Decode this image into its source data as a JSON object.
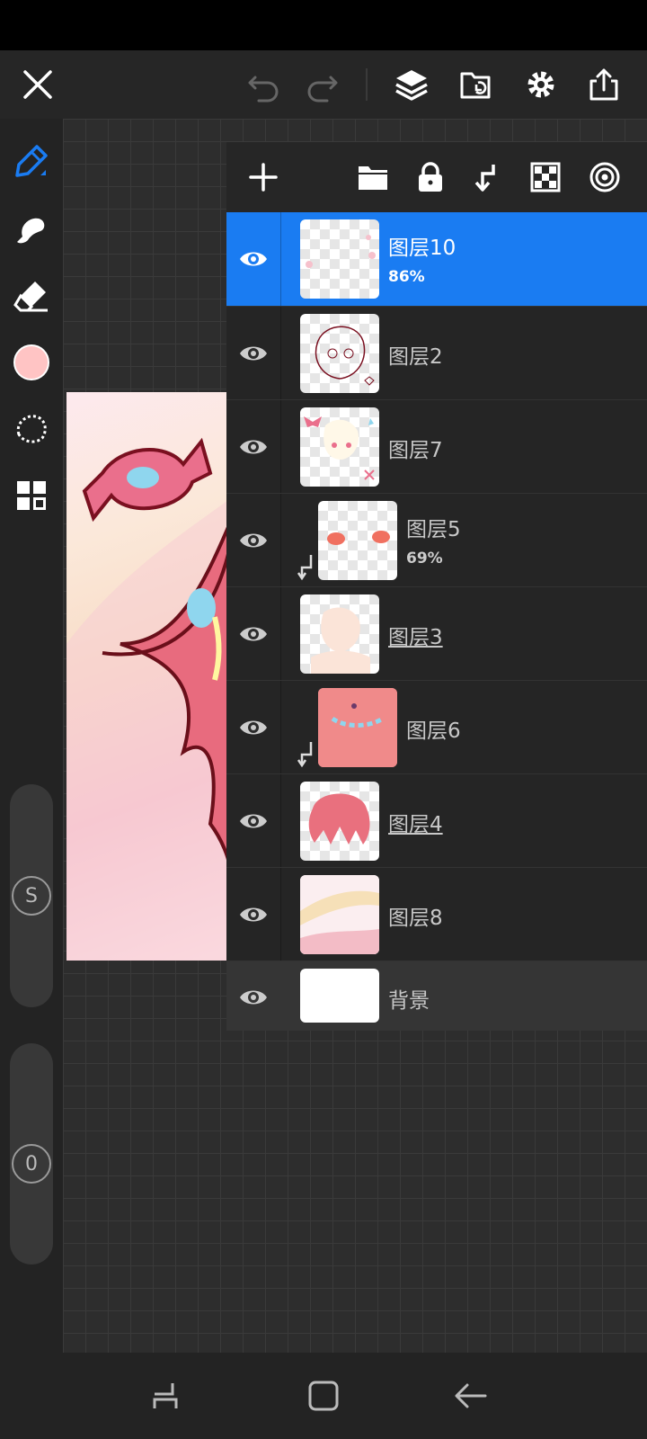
{
  "app": {
    "colors": {
      "accent": "#1a7cf2",
      "current_color": "#ffc4c4",
      "panel_bg": "#262626"
    }
  },
  "toolbar": {
    "icons": [
      "close-icon",
      "undo-icon",
      "redo-icon",
      "layers-icon",
      "import-icon",
      "settings-icon",
      "share-icon"
    ]
  },
  "left_tools": {
    "icons": [
      "pen-tool-icon",
      "smudge-icon",
      "eraser-icon",
      "color-swatch",
      "lasso-icon",
      "grid-icon"
    ],
    "size_slider_label": "S",
    "opacity_slider_label": "0"
  },
  "layer_panel": {
    "toolbar_icons": [
      "add-layer-icon",
      "folder-icon",
      "lock-icon",
      "merge-down-icon",
      "transparency-icon",
      "blend-icon"
    ],
    "layers": [
      {
        "name": "图层10",
        "opacity": "86%",
        "selected": true,
        "clipped": false,
        "underline": false
      },
      {
        "name": "图层2",
        "opacity": "",
        "selected": false,
        "clipped": false,
        "underline": false
      },
      {
        "name": "图层7",
        "opacity": "",
        "selected": false,
        "clipped": false,
        "underline": false
      },
      {
        "name": "图层5",
        "opacity": "69%",
        "selected": false,
        "clipped": true,
        "underline": false
      },
      {
        "name": "图层3",
        "opacity": "",
        "selected": false,
        "clipped": false,
        "underline": true
      },
      {
        "name": "图层6",
        "opacity": "",
        "selected": false,
        "clipped": true,
        "underline": false
      },
      {
        "name": "图层4",
        "opacity": "",
        "selected": false,
        "clipped": false,
        "underline": true
      },
      {
        "name": "图层8",
        "opacity": "",
        "selected": false,
        "clipped": false,
        "underline": false
      },
      {
        "name": "背景",
        "opacity": "",
        "selected": false,
        "clipped": false,
        "underline": false
      }
    ]
  },
  "navigation": {
    "icons": [
      "recent-apps-icon",
      "home-icon",
      "back-icon"
    ]
  }
}
